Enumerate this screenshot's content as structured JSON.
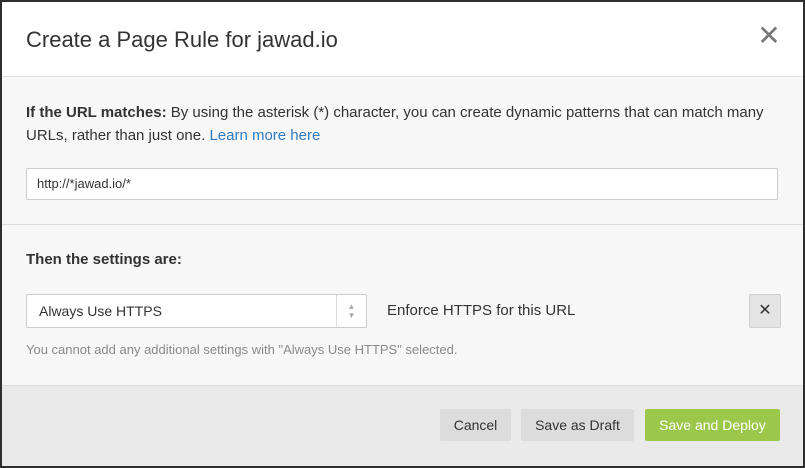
{
  "dialog": {
    "title": "Create a Page Rule for jawad.io",
    "close_icon": "close-icon"
  },
  "url_section": {
    "label": "If the URL matches:",
    "description": " By using the asterisk (*) character, you can create dynamic patterns that can match many URLs, rather than just one. ",
    "learn_more": "Learn more here",
    "input_value": "http://*jawad.io/*"
  },
  "settings_section": {
    "title": "Then the settings are:",
    "selected_setting": "Always Use HTTPS",
    "setting_description": "Enforce HTTPS for this URL",
    "note": "You cannot add any additional settings with \"Always Use HTTPS\" selected."
  },
  "footer": {
    "cancel": "Cancel",
    "save_draft": "Save as Draft",
    "save_deploy": "Save and Deploy"
  },
  "colors": {
    "primary_button": "#9bc84a",
    "link": "#2f7bbf"
  }
}
